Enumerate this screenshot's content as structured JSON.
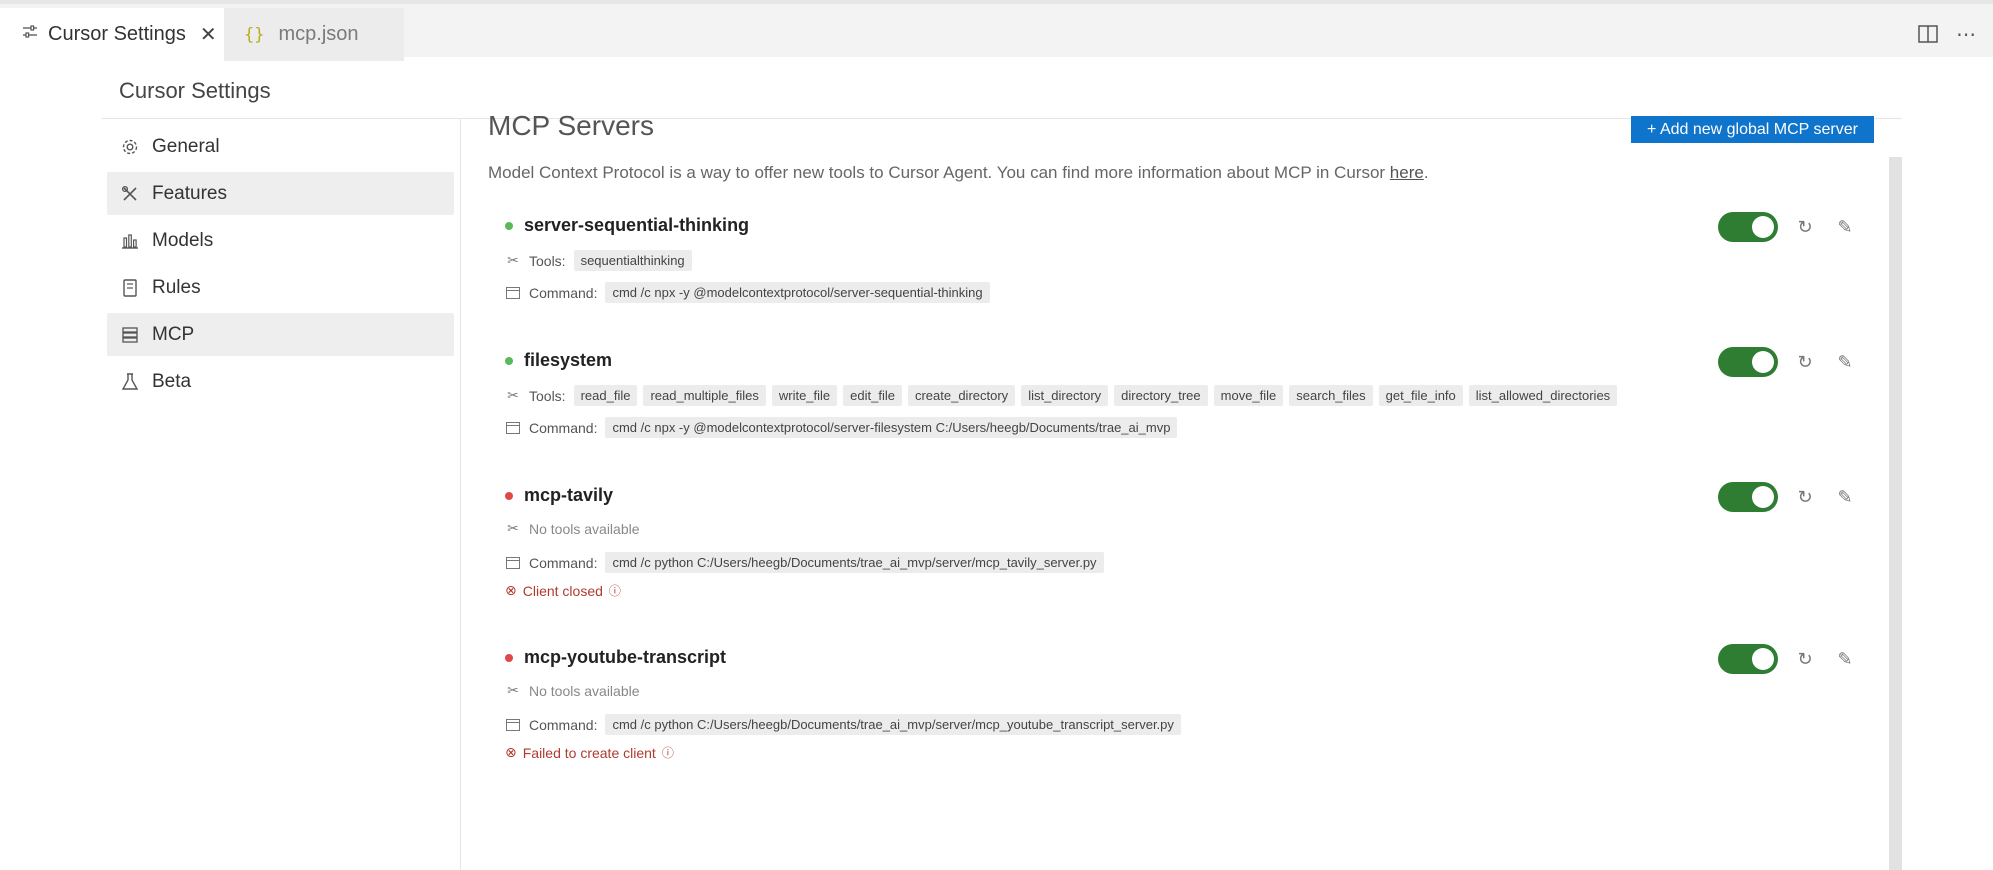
{
  "tabs": [
    {
      "label": "Cursor Settings",
      "icon": "settings-sliders-icon",
      "active": true
    },
    {
      "label": "mcp.json",
      "icon": "json-braces-icon",
      "active": false
    }
  ],
  "header": {
    "title": "Cursor Settings"
  },
  "sidebar": {
    "items": [
      {
        "label": "General",
        "icon": "gear-icon",
        "selected": false
      },
      {
        "label": "Features",
        "icon": "tools-icon",
        "selected": true
      },
      {
        "label": "Models",
        "icon": "bar-chart-icon",
        "selected": false
      },
      {
        "label": "Rules",
        "icon": "book-icon",
        "selected": false
      },
      {
        "label": "MCP",
        "icon": "server-stack-icon",
        "selected": true
      },
      {
        "label": "Beta",
        "icon": "flask-icon",
        "selected": false
      }
    ]
  },
  "main": {
    "title": "MCP Servers",
    "add_button": "+ Add new global MCP server",
    "description": "Model Context Protocol is a way to offer new tools to Cursor Agent. You can find more information about MCP in Cursor ",
    "description_link": "here",
    "description_end": "."
  },
  "labels": {
    "tools": "Tools:",
    "command": "Command:",
    "no_tools": "No tools available"
  },
  "servers": [
    {
      "name": "server-sequential-thinking",
      "status_color": "#5cb85c",
      "tools": [
        "sequentialthinking"
      ],
      "command": "cmd /c npx -y @modelcontextprotocol/server-sequential-thinking",
      "enabled": true,
      "error": ""
    },
    {
      "name": "filesystem",
      "status_color": "#5cb85c",
      "tools": [
        "read_file",
        "read_multiple_files",
        "write_file",
        "edit_file",
        "create_directory",
        "list_directory",
        "directory_tree",
        "move_file",
        "search_files",
        "get_file_info",
        "list_allowed_directories"
      ],
      "command": "cmd /c npx -y @modelcontextprotocol/server-filesystem C:/Users/heegb/Documents/trae_ai_mvp",
      "enabled": true,
      "error": ""
    },
    {
      "name": "mcp-tavily",
      "status_color": "#e04848",
      "tools": [],
      "command": "cmd /c python C:/Users/heegb/Documents/trae_ai_mvp/server/mcp_tavily_server.py",
      "enabled": true,
      "error": "Client closed"
    },
    {
      "name": "mcp-youtube-transcript",
      "status_color": "#e04848",
      "tools": [],
      "command": "cmd /c python C:/Users/heegb/Documents/trae_ai_mvp/server/mcp_youtube_transcript_server.py",
      "enabled": true,
      "error": "Failed to create client"
    }
  ],
  "colors": {
    "accent": "#0e74cc",
    "toggle_on": "#2e7d32",
    "error": "#b03a2e"
  }
}
